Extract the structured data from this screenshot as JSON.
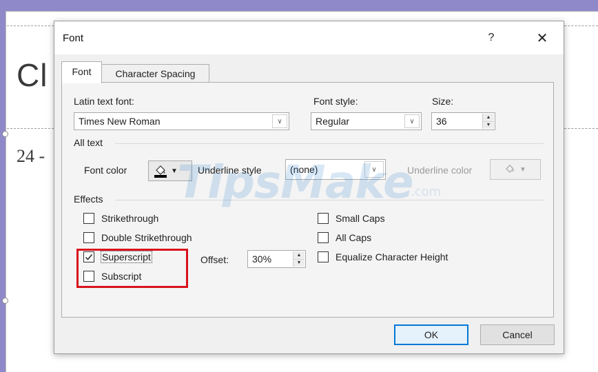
{
  "background": {
    "slide_title_fragment": "Cl",
    "slide_text_fragment": "24 -"
  },
  "dialog": {
    "title": "Font",
    "help_label": "?",
    "close_label": "✕",
    "tabs": [
      {
        "label": "Font",
        "selected": true
      },
      {
        "label": "Character Spacing",
        "selected": false
      }
    ],
    "latin_font_label": "Latin text font:",
    "latin_font_value": "Times New Roman",
    "font_style_label": "Font style:",
    "font_style_value": "Regular",
    "size_label": "Size:",
    "size_value": "36",
    "all_text_header": "All text",
    "font_color_label": "Font color",
    "underline_style_label": "Underline style",
    "underline_style_value": "(none)",
    "underline_color_label": "Underline color",
    "effects_header": "Effects",
    "effects": [
      {
        "label": "Strikethrough",
        "checked": false
      },
      {
        "label": "Double Strikethrough",
        "checked": false
      },
      {
        "label": "Superscript",
        "checked": true
      },
      {
        "label": "Subscript",
        "checked": false
      },
      {
        "label": "Small Caps",
        "checked": false
      },
      {
        "label": "All Caps",
        "checked": false
      },
      {
        "label": "Equalize Character Height",
        "checked": false
      }
    ],
    "offset_label": "Offset:",
    "offset_value": "30%",
    "ok_label": "OK",
    "cancel_label": "Cancel"
  },
  "watermark": {
    "text": "TipsMake",
    "suffix": ".com"
  },
  "colors": {
    "highlight_box": "#d8121c",
    "default_button_border": "#0078d7",
    "font_color_swatch": "#000000"
  }
}
